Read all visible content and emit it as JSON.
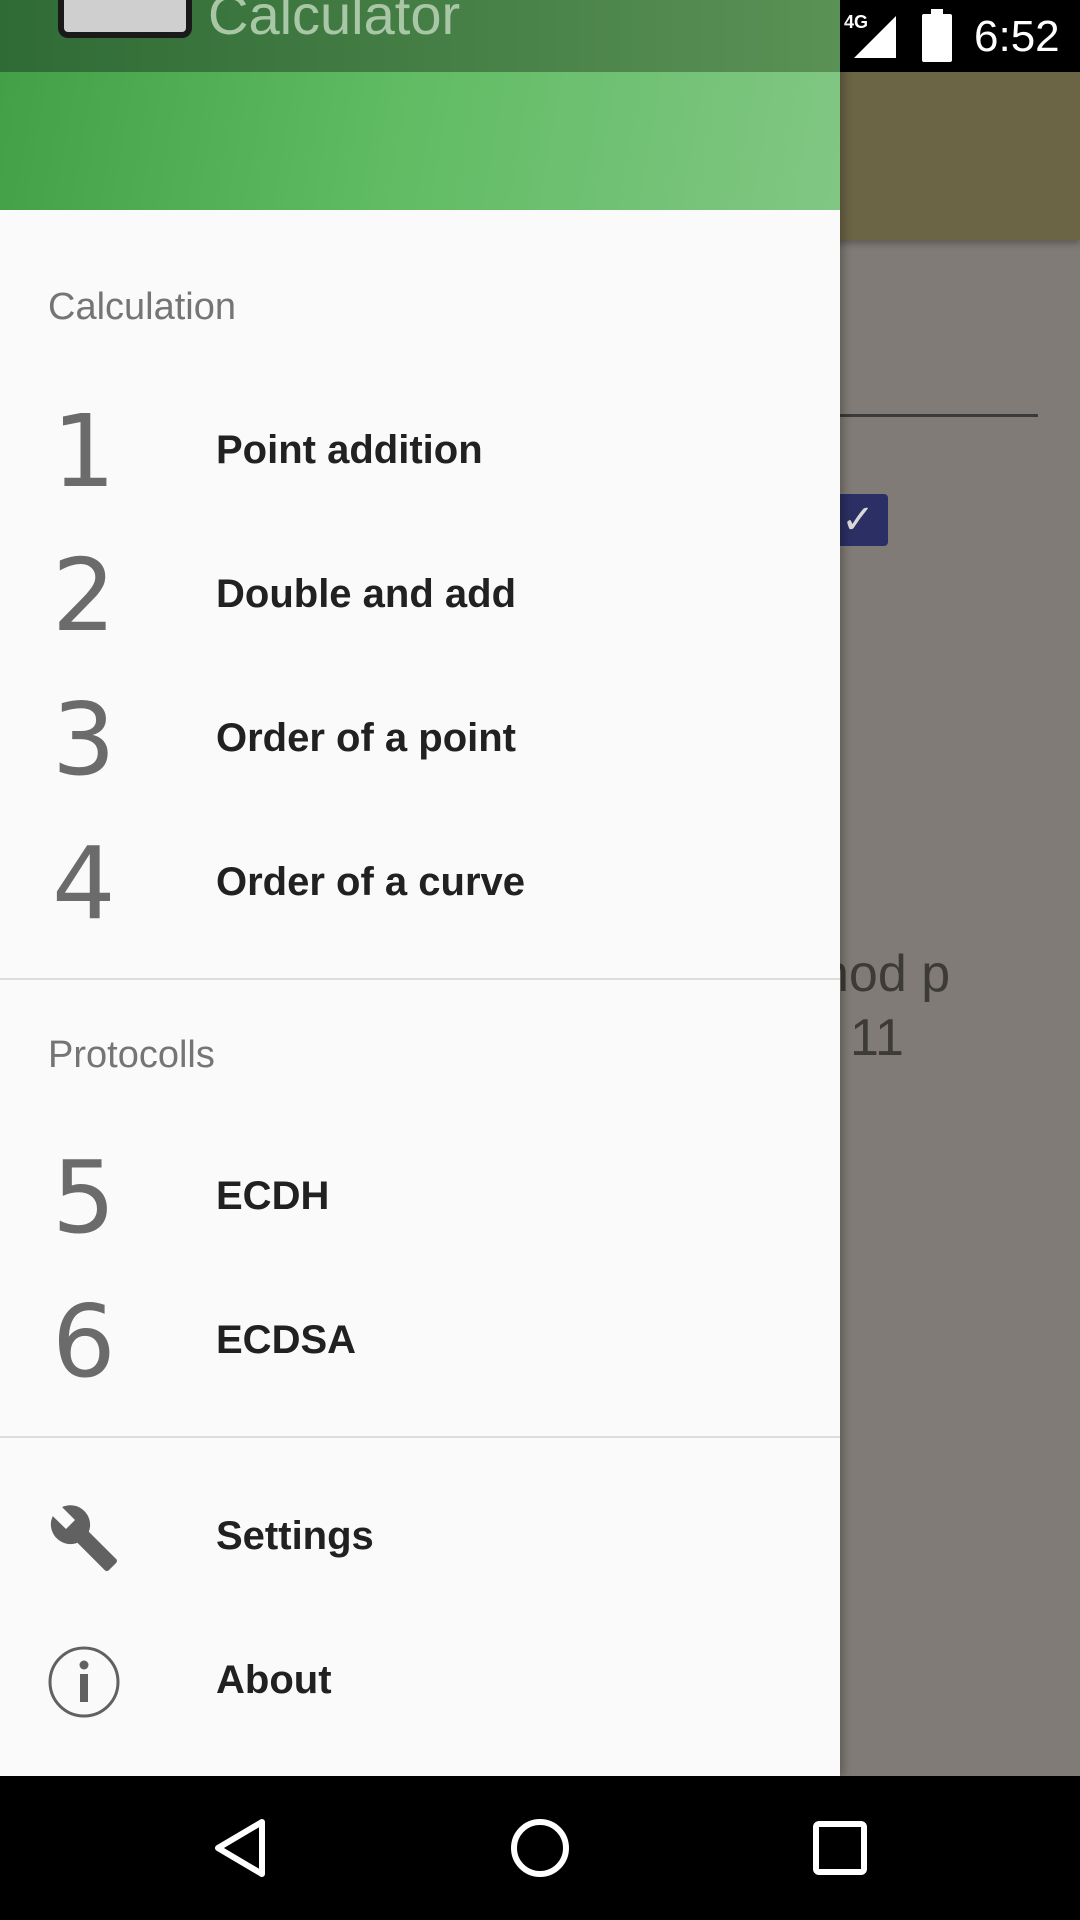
{
  "status_bar": {
    "network": "4G",
    "time": "6:52"
  },
  "app": {
    "title": "Calculator"
  },
  "background": {
    "text_line1": "nod p",
    "text_line2": "11"
  },
  "drawer": {
    "sections": [
      {
        "title": "Calculation",
        "items": [
          {
            "number": "1",
            "label": "Point addition"
          },
          {
            "number": "2",
            "label": "Double and add"
          },
          {
            "number": "3",
            "label": "Order of a point"
          },
          {
            "number": "4",
            "label": "Order of a curve"
          }
        ]
      },
      {
        "title": "Protocolls",
        "items": [
          {
            "number": "5",
            "label": "ECDH"
          },
          {
            "number": "6",
            "label": "ECDSA"
          }
        ]
      }
    ],
    "footer_items": [
      {
        "icon": "wrench-icon",
        "label": "Settings"
      },
      {
        "icon": "info-icon",
        "label": "About"
      }
    ]
  },
  "colors": {
    "header_green": "#4caf50",
    "drawer_bg": "#fafafa",
    "scrim": "#807b76"
  }
}
